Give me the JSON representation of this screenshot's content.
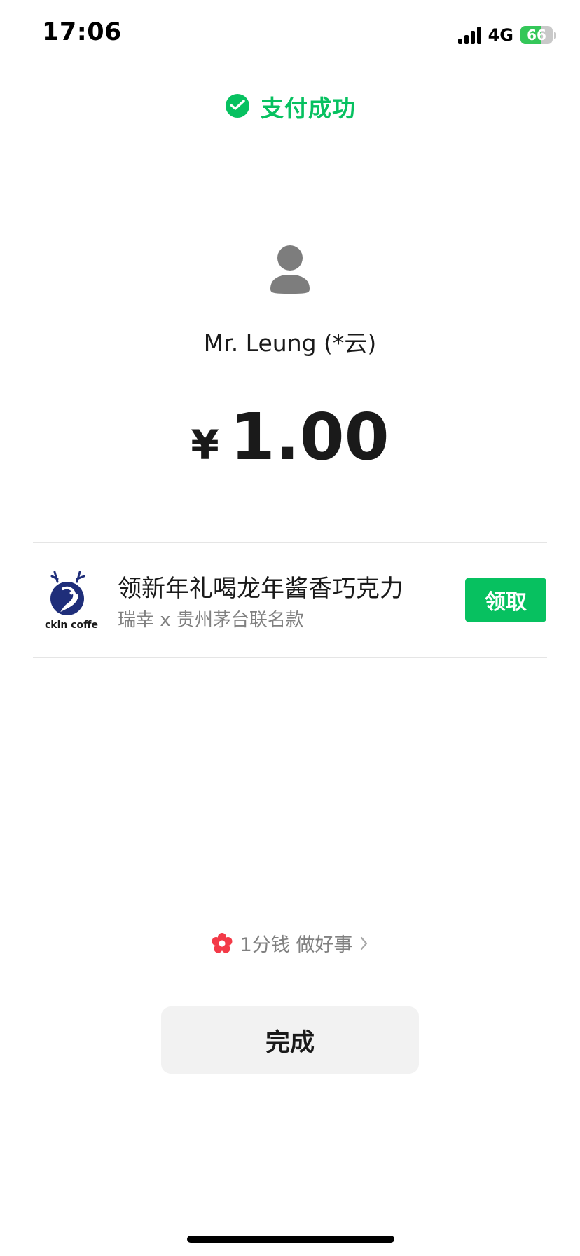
{
  "status_bar": {
    "time": "17:06",
    "network": "4G",
    "battery": "66",
    "battery_level": 0.66
  },
  "header": {
    "title": "支付成功",
    "icon": "wechat-pay-icon",
    "accent_color": "#07c160"
  },
  "payee": {
    "avatar_icon": "default-avatar-icon",
    "name": "Mr.  Leung (*云)"
  },
  "amount": {
    "currency": "¥",
    "value": "1.00"
  },
  "promo": {
    "logo_icon": "luckin-coffee-logo",
    "logo_text": "ckin coffe",
    "title": "领新年礼喝龙年酱香巧克力",
    "subtitle": "瑞幸 x 贵州茅台联名款",
    "button_label": "领取"
  },
  "charity": {
    "icon": "red-flower-icon",
    "label": "1分钱 做好事",
    "chevron_icon": "chevron-right-icon"
  },
  "footer": {
    "done_label": "完成"
  }
}
